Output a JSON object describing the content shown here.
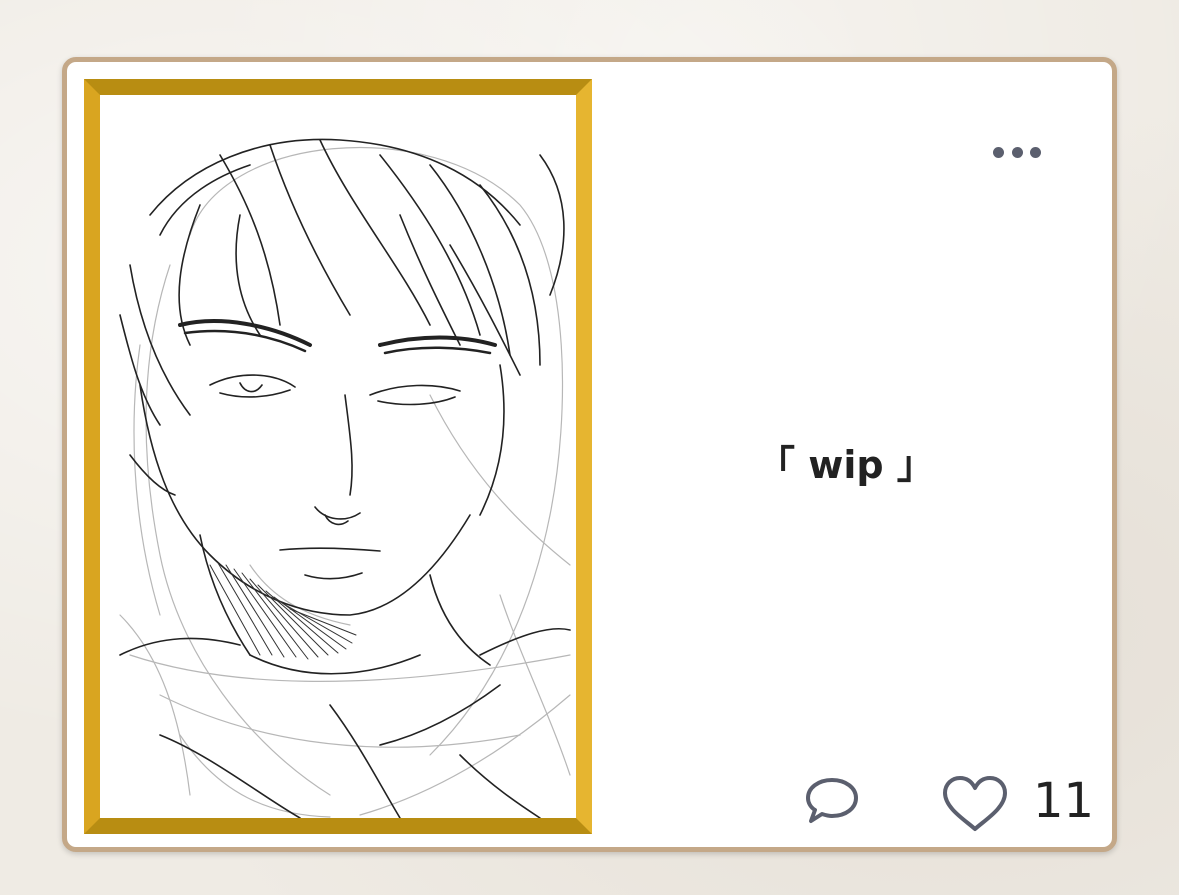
{
  "post": {
    "caption": "「 wip 」",
    "like_count": "11"
  },
  "icons": {
    "more": "more-horizontal-icon",
    "comment": "comment-bubble-icon",
    "like": "heart-outline-icon"
  },
  "colors": {
    "frame_gold": "#e0ae2a",
    "card_border": "#c4a888",
    "icon_gray": "#5b5f6e",
    "background": "#efebe4"
  }
}
